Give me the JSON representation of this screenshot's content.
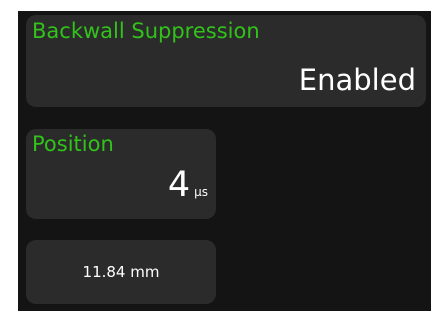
{
  "backwall_suppression": {
    "label": "Backwall Suppression",
    "value": "Enabled"
  },
  "position": {
    "label": "Position",
    "value": "4",
    "unit": "µs"
  },
  "distance": {
    "value": "11.84 mm"
  },
  "colors": {
    "label_green": "#31c31a",
    "tile_bg": "#2b2b2b",
    "panel_bg": "#141414",
    "value_text": "#ffffff"
  }
}
